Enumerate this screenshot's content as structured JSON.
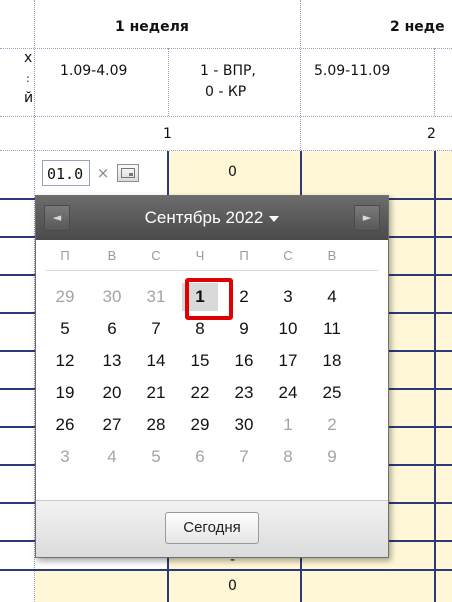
{
  "table": {
    "week1_header": "1 неделя",
    "week2_header": "2 неде",
    "row_header_partial": [
      "х",
      ":",
      "й"
    ],
    "week1_dates": "1.09-4.09",
    "week1_notes_line1": "1 - ВПР,",
    "week1_notes_line2": "0 - КР",
    "week2_dates": "5.09-11.09",
    "week1_number": "1",
    "week2_number": "2",
    "value_cell_top": "0",
    "value_cell_bottom": "0",
    "value_dash": "-"
  },
  "date_input": {
    "value": "01.0",
    "clear_symbol": "×"
  },
  "datepicker": {
    "month_title": "Сентябрь 2022",
    "prev_symbol": "◄",
    "next_symbol": "►",
    "weekdays": [
      "П",
      "В",
      "С",
      "Ч",
      "П",
      "С",
      "В"
    ],
    "weeks": [
      [
        "29",
        "30",
        "31",
        "1",
        "2",
        "3",
        "4"
      ],
      [
        "5",
        "6",
        "7",
        "8",
        "9",
        "10",
        "11"
      ],
      [
        "12",
        "13",
        "14",
        "15",
        "16",
        "17",
        "18"
      ],
      [
        "19",
        "20",
        "21",
        "22",
        "23",
        "24",
        "25"
      ],
      [
        "26",
        "27",
        "28",
        "29",
        "30",
        "1",
        "2"
      ],
      [
        "3",
        "4",
        "5",
        "6",
        "7",
        "8",
        "9"
      ]
    ],
    "selected_day": "1",
    "today_label": "Сегодня",
    "highlight_color": "#e00000"
  }
}
